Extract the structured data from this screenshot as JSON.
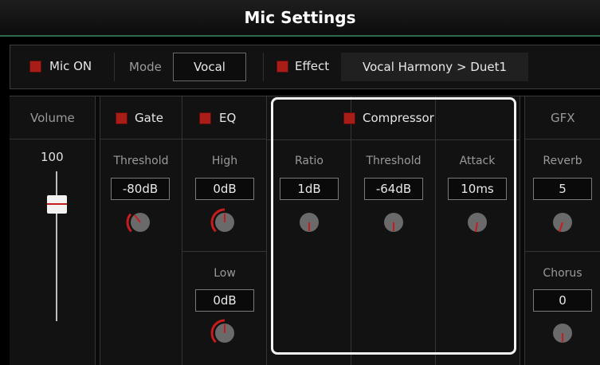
{
  "title": "Mic Settings",
  "top": {
    "mic_on_label": "Mic ON",
    "mode_label": "Mode",
    "mode_value": "Vocal",
    "effect_label": "Effect",
    "effect_value": "Vocal Harmony > Duet1"
  },
  "volume": {
    "label": "Volume",
    "value": "100",
    "level": 1.0
  },
  "gate": {
    "label": "Gate",
    "threshold_label": "Threshold",
    "threshold_value": "-80dB"
  },
  "eq": {
    "label": "EQ",
    "high_label": "High",
    "high_value": "0dB",
    "low_label": "Low",
    "low_value": "0dB"
  },
  "compressor": {
    "label": "Compressor",
    "ratio_label": "Ratio",
    "ratio_value": "1dB",
    "threshold_label": "Threshold",
    "threshold_value": "-64dB",
    "attack_label": "Attack",
    "attack_value": "10ms"
  },
  "gfx": {
    "label": "GFX",
    "reverb_label": "Reverb",
    "reverb_value": "5",
    "chorus_label": "Chorus",
    "chorus_value": "0"
  },
  "colors": {
    "accent_red": "#c81c1c",
    "checkbox_red": "#a81d17",
    "title_rule": "#2e6b4d"
  }
}
